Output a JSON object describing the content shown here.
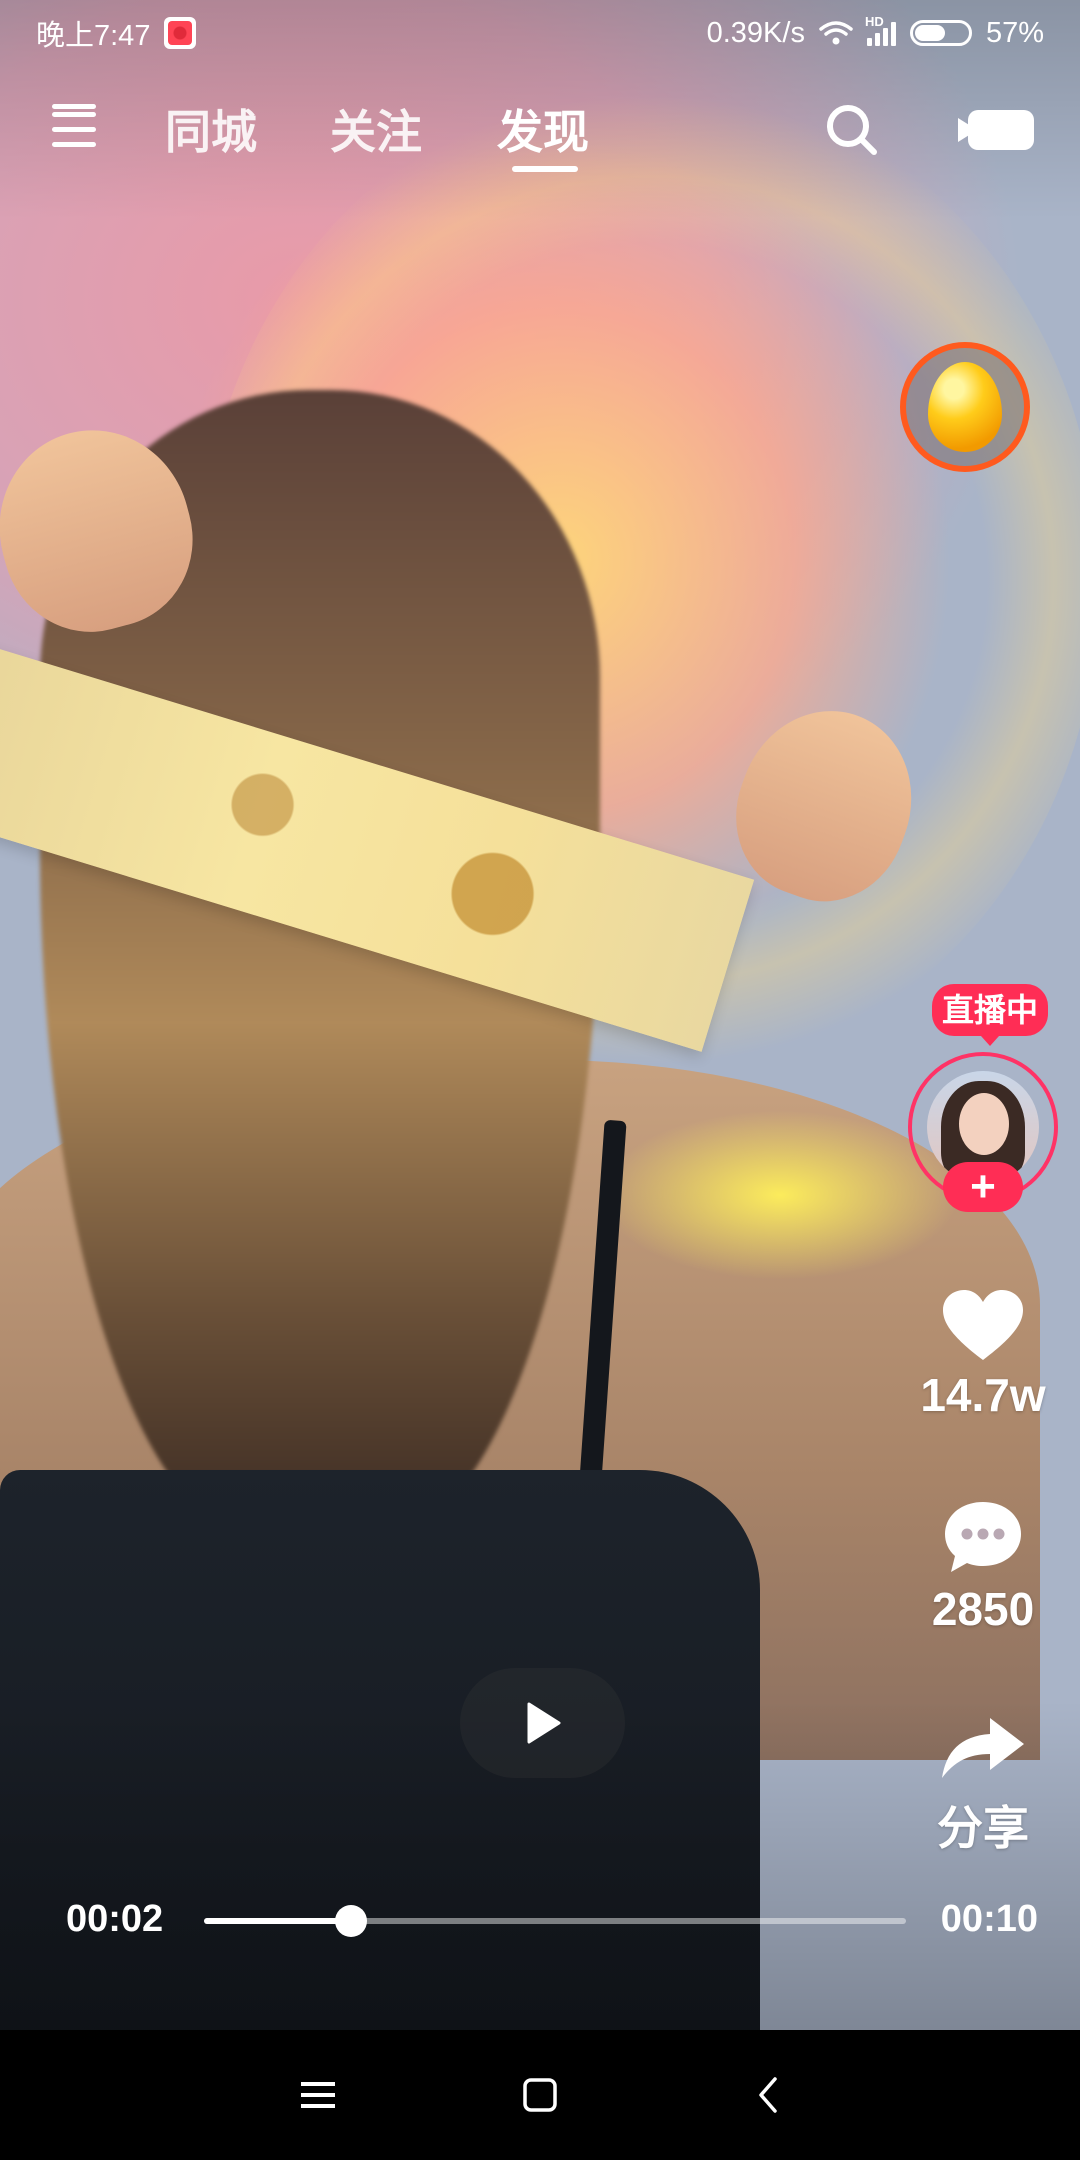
{
  "status_bar": {
    "time": "晚上7:47",
    "net_speed": "0.39K/s",
    "network_type": "HD",
    "battery": "57%",
    "battery_level": 0.57
  },
  "top_nav": {
    "tabs": [
      {
        "label": "同城"
      },
      {
        "label": "关注"
      },
      {
        "label": "发现"
      }
    ],
    "active_tab": "发现",
    "menu_has_notification": true,
    "icons": {
      "menu": "menu-icon",
      "search": "search-icon",
      "camera": "video-camera-icon"
    }
  },
  "right_rail": {
    "live_badge": "直播中",
    "follow_symbol": "+",
    "likes": "14.7w",
    "comments": "2850",
    "share_label": "分享",
    "icons": {
      "like": "heart-icon",
      "comment": "comment-bubble-icon",
      "share": "share-arrow-icon",
      "reward": "golden-egg-icon"
    }
  },
  "player": {
    "current_time": "00:02",
    "total_time": "00:10",
    "progress": 0.21,
    "state": "paused"
  },
  "colors": {
    "accent": "#ff2d55",
    "egg_ring": "#ff5a1e"
  }
}
